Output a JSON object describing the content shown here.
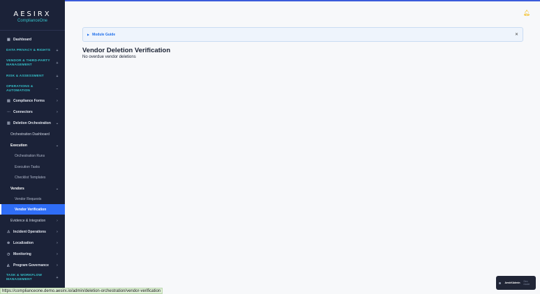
{
  "brand": {
    "name": "AESIRX",
    "product": "ComplianceOne"
  },
  "sidebar": {
    "dashboard": "Dashboard",
    "sections": {
      "data_privacy": "DATA PRIVACY & RIGHTS",
      "vendor_mgmt": "VENDOR & THIRD-PARTY MANAGEMENT",
      "risk": "RISK & ASSESSMENT",
      "operations": "OPERATIONS & AUTOMATION",
      "task": "TASK & WORKFLOW MANAGEMENT"
    },
    "items": {
      "compliance_forms": "Compliance Forms",
      "connectors": "Connectors",
      "deletion_orchestration": "Deletion Orchestration",
      "orchestration_dashboard": "Orchestration Dashboard",
      "execution": "Execution",
      "orchestration_runs": "Orchestration Runs",
      "execution_tasks": "Execution Tasks",
      "checklist_templates": "Checklist Templates",
      "vendors": "Vendors",
      "vendor_requests": "Vendor Requests",
      "vendor_verification": "Vendor Verification",
      "evidence_integration": "Evidence & Integration",
      "incident_operations": "Incident Operations",
      "localization": "Localization",
      "monitoring": "Monitoring",
      "program_governance": "Program Governance"
    }
  },
  "main": {
    "guide_label": "Module Guide",
    "title": "Vendor Deletion Verification",
    "subtitle": "No overdue vendor deletions"
  },
  "toast": {
    "primary": "AesirXAdmin",
    "secondary": "Dev mode"
  },
  "status_url": "https://complianceone.demo.aesirx.io/admin/deletion-orchestration/vendor-verification",
  "colors": {
    "sidebar_bg": "#1b2238",
    "accent": "#35c0c8",
    "active": "#2f6df6",
    "link": "#1f6feb",
    "bell": "#f2b705"
  }
}
